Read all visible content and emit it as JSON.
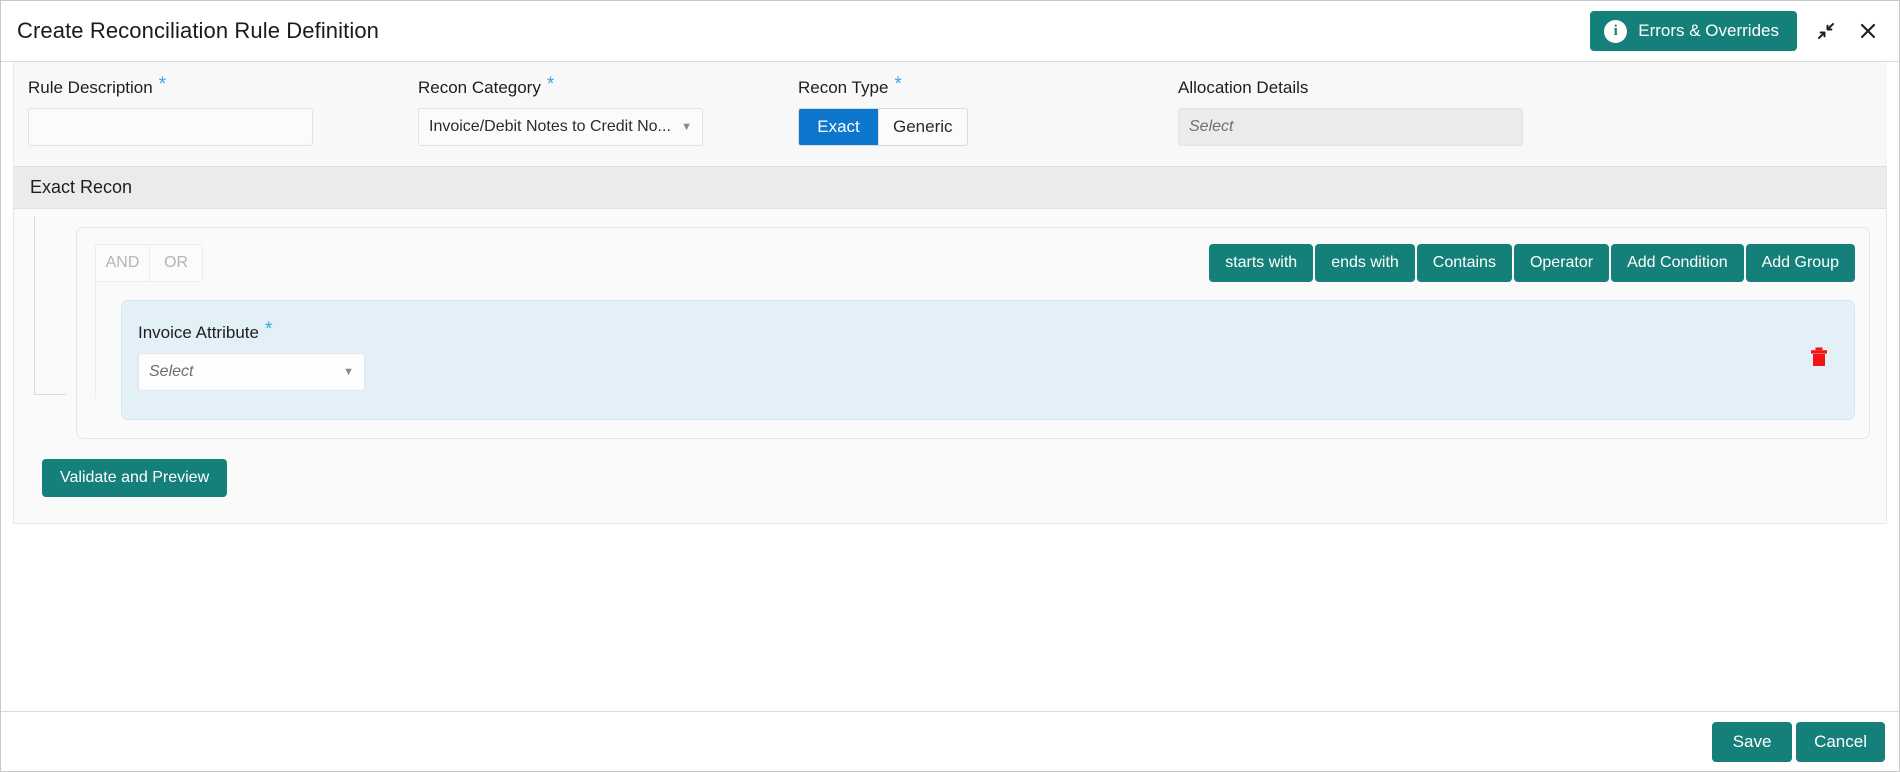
{
  "window": {
    "title": "Create Reconciliation Rule Definition",
    "errors_button": "Errors & Overrides",
    "info_glyph": "i",
    "minimize_icon": "collapse-arrows-icon",
    "close_icon": "close-icon"
  },
  "form": {
    "rule_description": {
      "label": "Rule Description",
      "required": "*",
      "value": "",
      "placeholder": ""
    },
    "recon_category": {
      "label": "Recon Category",
      "required": "*",
      "value": "Invoice/Debit Notes to Credit No...",
      "caret": "▼"
    },
    "recon_type": {
      "label": "Recon Type",
      "required": "*",
      "options": [
        "Exact",
        "Generic"
      ],
      "selected": "Exact"
    },
    "allocation_details": {
      "label": "Allocation Details",
      "placeholder": "Select"
    }
  },
  "panel": {
    "header": "Exact Recon",
    "logic": {
      "options": [
        "AND",
        "OR"
      ],
      "selected": ""
    },
    "operator_buttons": [
      {
        "label": "starts with"
      },
      {
        "label": "ends with"
      },
      {
        "label": "Contains"
      },
      {
        "label": "Operator"
      },
      {
        "label": "Add Condition"
      },
      {
        "label": "Add Group"
      }
    ],
    "condition": {
      "label": "Invoice Attribute",
      "required": "*",
      "placeholder": "Select",
      "caret": "▼",
      "delete_icon": "trash-icon"
    },
    "validate_button": "Validate and Preview"
  },
  "footer": {
    "save": "Save",
    "cancel": "Cancel"
  },
  "colors": {
    "teal": "#15807a",
    "blue": "#0c77cc",
    "card_blue": "#e4f0f8",
    "required_asterisk": "#3fa6e0",
    "trash_red": "#f01414"
  }
}
